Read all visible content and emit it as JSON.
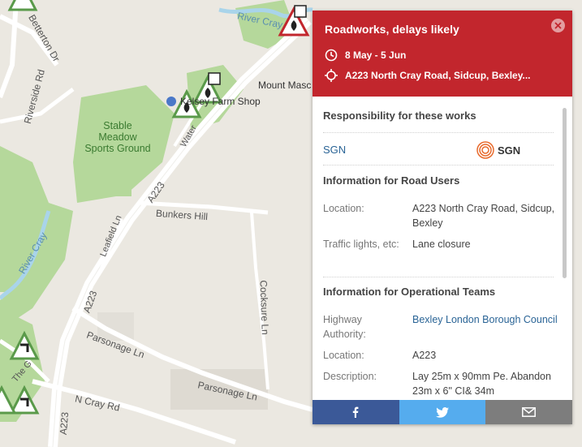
{
  "map": {
    "labels": {
      "river_cray_top": "River Cray",
      "river_cray_left": "River Cray",
      "betterton": "Betterton Dr",
      "riverside": "Riverside Rd",
      "farm_shop": "Kelsey Farm Shop",
      "mount_mascal": "Mount Masc",
      "stable_meadow": "Stable\nMeadow\nSports Ground",
      "a223_mid": "A223",
      "a223_low": "A223",
      "a223_bottom": "A223",
      "bunkers_hill": "Bunkers Hill",
      "leafield": "Leafield Ln",
      "cocksure": "Cocksure Ln",
      "parsonage_1": "Parsonage Ln",
      "parsonage_2": "Parsonage Ln",
      "n_cray": "N Cray Rd",
      "water_lane": "Water",
      "the_green": "The G"
    },
    "colors": {
      "background": "#ebe8e1",
      "green": "#a9d08e",
      "water": "#a9d4ea",
      "road": "#ffffff",
      "marker_green": "#5a9a4a",
      "marker_red": "#c2262d"
    }
  },
  "popup": {
    "title": "Roadworks, delays likely",
    "dates": "8 May - 5 Jun",
    "location_short": "A223 North Cray Road, Sidcup, Bexley...",
    "responsibility": {
      "heading": "Responsibility for these works",
      "company_link": "SGN",
      "logo_text": "SGN"
    },
    "road_users": {
      "heading": "Information for Road Users",
      "location_label": "Location:",
      "location_value": "A223 North Cray Road, Sidcup, Bexley",
      "traffic_label": "Traffic lights, etc:",
      "traffic_value": "Lane closure"
    },
    "operational": {
      "heading": "Information for Operational Teams",
      "authority_label": "Highway Authority:",
      "authority_value": "Bexley London Borough Council",
      "location_label": "Location:",
      "location_value": "A223",
      "description_label": "Description:",
      "description_value": "Lay 25m x 90mm Pe. Abandon 23m x 6\" CI& 34m"
    },
    "share": {
      "facebook_color": "#3b5998",
      "twitter_color": "#55acee",
      "email_color": "#7d7d7d"
    },
    "colors": {
      "header": "#c2262d",
      "link": "#2a6496"
    }
  }
}
